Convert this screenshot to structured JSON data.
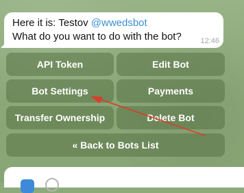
{
  "message": {
    "line1_prefix": "Here it is: Testov ",
    "mention": "@wwedsbot",
    "line2": "What do you want to do with the bot?",
    "time": "12:46"
  },
  "keyboard": {
    "api_token": "API Token",
    "edit_bot": "Edit Bot",
    "bot_settings": "Bot Settings",
    "payments": "Payments",
    "transfer_ownership": "Transfer Ownership",
    "delete_bot": "Delete Bot",
    "back_to_bots_list": "« Back to Bots List"
  },
  "annotation": {
    "arrow_color": "#e03a2a"
  },
  "icons": {
    "composer_left": "attach-icon",
    "composer_right": "emoji-icon"
  }
}
